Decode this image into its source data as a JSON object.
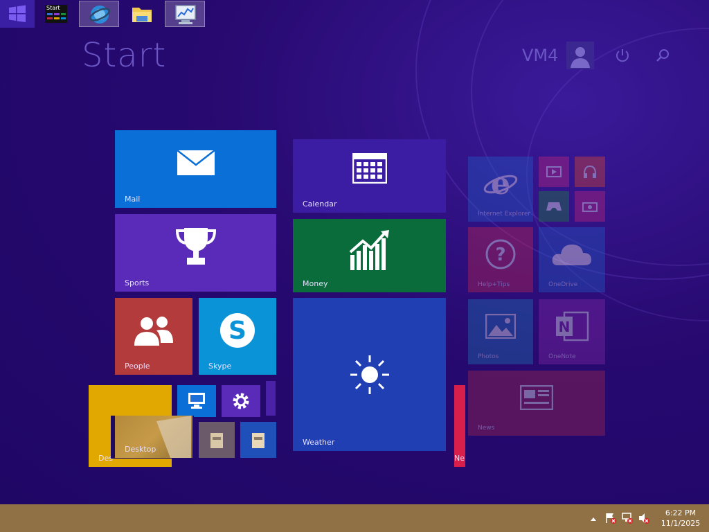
{
  "header": {
    "title": "Start",
    "user_name": "VM4"
  },
  "tiles": {
    "mail": "Mail",
    "calendar": "Calendar",
    "sports": "Sports",
    "money": "Money",
    "people": "People",
    "skype": "Skype",
    "weather": "Weather",
    "desktop": "Desktop",
    "desktop_partial": "Des",
    "news_partial": "Ne",
    "internet_explorer": "Internet Explorer",
    "help": "Help+Tips",
    "onedrive": "OneDrive",
    "photos": "Photos",
    "onenote": "OneNote",
    "news": "News"
  },
  "taskbar": {
    "items": [
      {
        "name": "Start",
        "icon": "start-thumbnail-icon"
      },
      {
        "name": "Internet Explorer",
        "icon": "ie-globe-icon"
      },
      {
        "name": "File Explorer",
        "icon": "folder-icon"
      },
      {
        "name": "Performance Monitor",
        "icon": "monitor-chart-icon"
      }
    ],
    "thumb_label": "Start"
  },
  "tray": {
    "time": "6:22 PM",
    "date": "11/1/2025"
  },
  "colors": {
    "background": "#23096b",
    "mail": "#0a6fd6",
    "calendar": "#3b1da3",
    "sports": "#5a2ab8",
    "money": "#0a6b3b",
    "people": "#b33b3b",
    "skype": "#0a93d6",
    "weather": "#1f3fb3",
    "taskbar": "#8f7145"
  }
}
